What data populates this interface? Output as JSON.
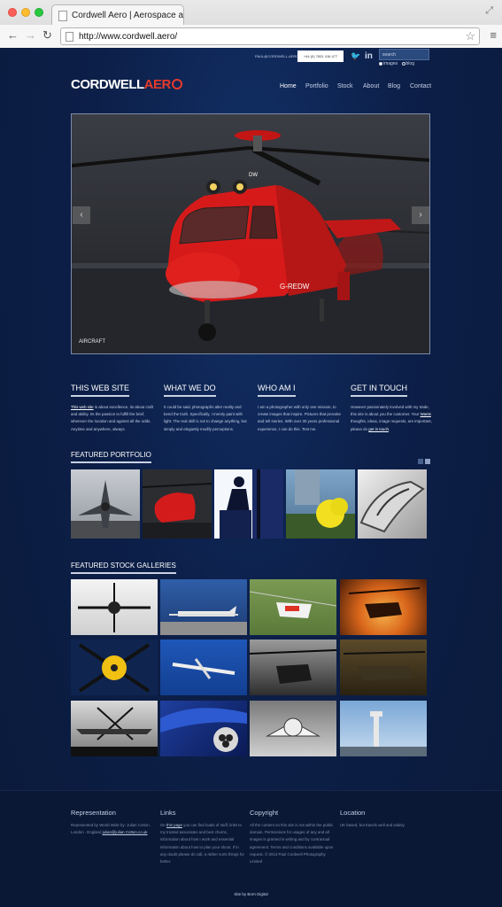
{
  "browser": {
    "tab_title": "Cordwell Aero | Aerospace and",
    "url": "http://www.cordwell.aero/"
  },
  "header": {
    "email": "PAUL@CORDWELL.AERO",
    "phone": "+44 (0) 7831 416 477",
    "search_placeholder": "search",
    "radio_images": "images",
    "radio_blog": "blog",
    "logo_main": "CORDWELL",
    "logo_accent": "AER",
    "nav": [
      "Home",
      "Portfolio",
      "Stock",
      "About",
      "Blog",
      "Contact"
    ]
  },
  "slider": {
    "caption": "AIRCRAFT",
    "prev": "‹",
    "next": "›",
    "reg": "G-REDW",
    "nose": "DW"
  },
  "columns": [
    {
      "title": "THIS WEB SITE",
      "link": "This web site",
      "text": " is about excellence, its about craft and ability. Its the passion to fulfill the brief, wherever the location and against all the odds. Anytime and anywhere, always."
    },
    {
      "title": "WHAT WE DO",
      "text": "It could be said, photographs alter reality and bend the truth. Specifically, I merely paint with light. The real skill is not to change anything, but simply and elegantly modify perceptions."
    },
    {
      "title": "WHO AM I",
      "text": "I am a photographer with only one mission, to create images that inspire. Pictures that provoke and tell stories. With over 30 years professional experience, I can do this. Test me."
    },
    {
      "title": "GET IN TOUCH",
      "text1": "However passionately involved with my trade, this site is about you the customer. Your ",
      "link1": "Wants",
      "text2": " thoughts, ideas, image requests, are important, please do ",
      "link2": "get in touch",
      "text3": "."
    }
  ],
  "featured_portfolio": {
    "title": "FEATURED PORTFOLIO"
  },
  "featured_stock": {
    "title": "FEATURED STOCK GALLERIES"
  },
  "footer": {
    "representation": {
      "title": "Representation",
      "text": "Represented by World Wide by: Julian Cotton . London . England ",
      "link": "julian@julian Cotton.co.uk"
    },
    "links": {
      "title": "Links",
      "pre": "On ",
      "link": "this page",
      "text": " you can find loads of stuff, links to my trusted associates and best chums, information about how I work and essential information about how to plan your shoot. If in any doubt please do call, a rather sorts things for better."
    },
    "copyright": {
      "title": "Copyright",
      "text": "All the content on this site is not within the public domain. Permissions for usages of any and all images is granted in writing and by contractual agreement. Terms and conditions available upon request. © 2013 Paul Cordwell Photography Limited"
    },
    "location": {
      "title": "Location",
      "text": "UK based, but travels well and widely."
    },
    "credit": "Site by Born Digital"
  }
}
